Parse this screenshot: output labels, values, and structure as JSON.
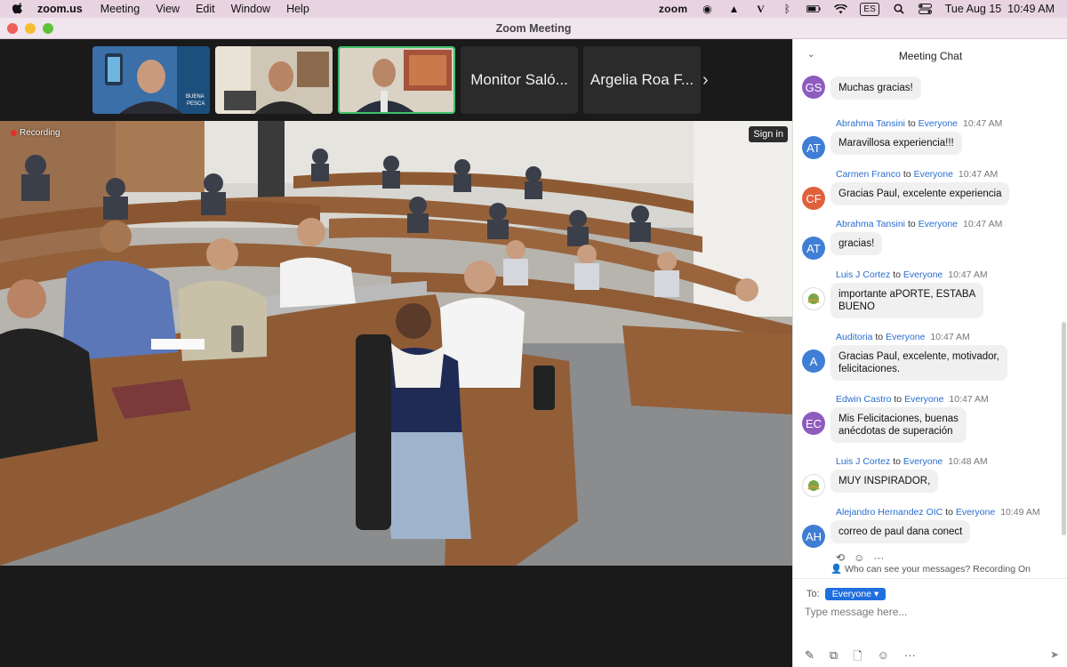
{
  "menubar": {
    "app_name": "zoom.us",
    "menus": [
      "Meeting",
      "View",
      "Edit",
      "Window",
      "Help"
    ],
    "zoom_label": "zoom",
    "input_source": "ES",
    "datetime": "Tue Aug 15  10:49 AM"
  },
  "window": {
    "title": "Zoom Meeting"
  },
  "gallery": {
    "named_tiles": [
      "Monitor Saló...",
      "Argelia Roa F..."
    ],
    "next_label": "›"
  },
  "stage": {
    "recording_label": "Recording",
    "signin_label": "Sign in"
  },
  "chat": {
    "title": "Meeting Chat",
    "to_word": "to",
    "messages": [
      {
        "initials": "GS",
        "color": "#8e5bbf",
        "sender": "",
        "recipient": "",
        "time": "",
        "text": "Muchas gracias!"
      },
      {
        "initials": "AT",
        "color": "#3f7ed4",
        "sender": "Abrahma Tansini",
        "recipient": "Everyone",
        "time": "10:47 AM",
        "text": "Maravillosa experiencia!!!"
      },
      {
        "initials": "CF",
        "color": "#e0603a",
        "sender": "Carmen Franco",
        "recipient": "Everyone",
        "time": "10:47 AM",
        "text": "Gracias Paul, excelente experiencia"
      },
      {
        "initials": "AT",
        "color": "#3f7ed4",
        "sender": "Abrahma Tansini",
        "recipient": "Everyone",
        "time": "10:47 AM",
        "text": "gracias!"
      },
      {
        "initials": "",
        "color": "#ffffff",
        "sender": "Luis J Cortez",
        "recipient": "Everyone",
        "time": "10:47 AM",
        "text": "importante aPORTE, ESTABA\nBUENO"
      },
      {
        "initials": "A",
        "color": "#3f7ed4",
        "sender": "Auditoria",
        "recipient": "Everyone",
        "time": "10:47 AM",
        "text": "Gracias Paul, excelente, motivador,\nfelicitaciones."
      },
      {
        "initials": "EC",
        "color": "#8e5bbf",
        "sender": "Edwin Castro",
        "recipient": "Everyone",
        "time": "10:47 AM",
        "text": "Mis Felicitaciones, buenas\nanécdotas de superación"
      },
      {
        "initials": "",
        "color": "#ffffff",
        "sender": "Luis J Cortez",
        "recipient": "Everyone",
        "time": "10:48 AM",
        "text": "MUY INSPIRADOR,"
      },
      {
        "initials": "AH",
        "color": "#3f7ed4",
        "sender": "Alejandro Hernandez OIC",
        "recipient": "Everyone",
        "time": "10:49 AM",
        "text": "correo de paul  dana conect"
      }
    ],
    "privacy_notice": "Who can see your messages? Recording On",
    "to_label": "To:",
    "recipient_select": "Everyone",
    "input_placeholder": "Type message here..."
  }
}
